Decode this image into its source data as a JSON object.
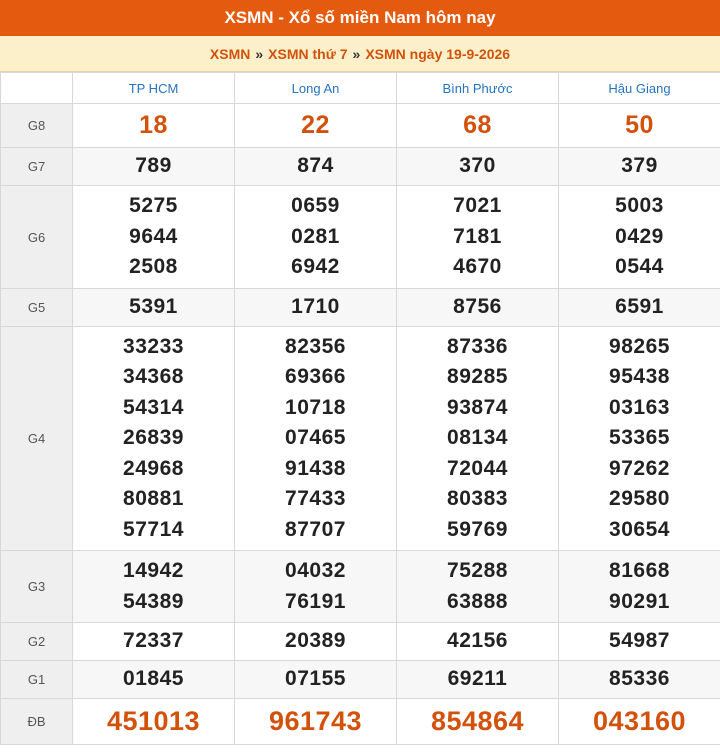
{
  "header": {
    "title": "XSMN - Xổ số miền Nam hôm nay"
  },
  "breadcrumb": {
    "items": [
      "XSMN",
      "XSMN thứ 7",
      "XSMN ngày 19-9-2026"
    ],
    "separator": "»"
  },
  "colors": {
    "header_bg": "#e45a0e",
    "breadcrumb_bg": "#fbf0c9",
    "accent": "#d2520c",
    "province_link": "#2573c1"
  },
  "table": {
    "provinces": [
      "TP HCM",
      "Long An",
      "Bình Phước",
      "Hậu Giang"
    ],
    "rows": [
      {
        "label": "G8",
        "cells": [
          [
            "18"
          ],
          [
            "22"
          ],
          [
            "68"
          ],
          [
            "50"
          ]
        ]
      },
      {
        "label": "G7",
        "cells": [
          [
            "789"
          ],
          [
            "874"
          ],
          [
            "370"
          ],
          [
            "379"
          ]
        ]
      },
      {
        "label": "G6",
        "cells": [
          [
            "5275",
            "9644",
            "2508"
          ],
          [
            "0659",
            "0281",
            "6942"
          ],
          [
            "7021",
            "7181",
            "4670"
          ],
          [
            "5003",
            "0429",
            "0544"
          ]
        ]
      },
      {
        "label": "G5",
        "cells": [
          [
            "5391"
          ],
          [
            "1710"
          ],
          [
            "8756"
          ],
          [
            "6591"
          ]
        ]
      },
      {
        "label": "G4",
        "cells": [
          [
            "33233",
            "34368",
            "54314",
            "26839",
            "24968",
            "80881",
            "57714"
          ],
          [
            "82356",
            "69366",
            "10718",
            "07465",
            "91438",
            "77433",
            "87707"
          ],
          [
            "87336",
            "89285",
            "93874",
            "08134",
            "72044",
            "80383",
            "59769"
          ],
          [
            "98265",
            "95438",
            "03163",
            "53365",
            "97262",
            "29580",
            "30654"
          ]
        ]
      },
      {
        "label": "G3",
        "cells": [
          [
            "14942",
            "54389"
          ],
          [
            "04032",
            "76191"
          ],
          [
            "75288",
            "63888"
          ],
          [
            "81668",
            "90291"
          ]
        ]
      },
      {
        "label": "G2",
        "cells": [
          [
            "72337"
          ],
          [
            "20389"
          ],
          [
            "42156"
          ],
          [
            "54987"
          ]
        ]
      },
      {
        "label": "G1",
        "cells": [
          [
            "01845"
          ],
          [
            "07155"
          ],
          [
            "69211"
          ],
          [
            "85336"
          ]
        ]
      },
      {
        "label": "ĐB",
        "cells": [
          [
            "451013"
          ],
          [
            "961743"
          ],
          [
            "854864"
          ],
          [
            "043160"
          ]
        ]
      }
    ]
  }
}
